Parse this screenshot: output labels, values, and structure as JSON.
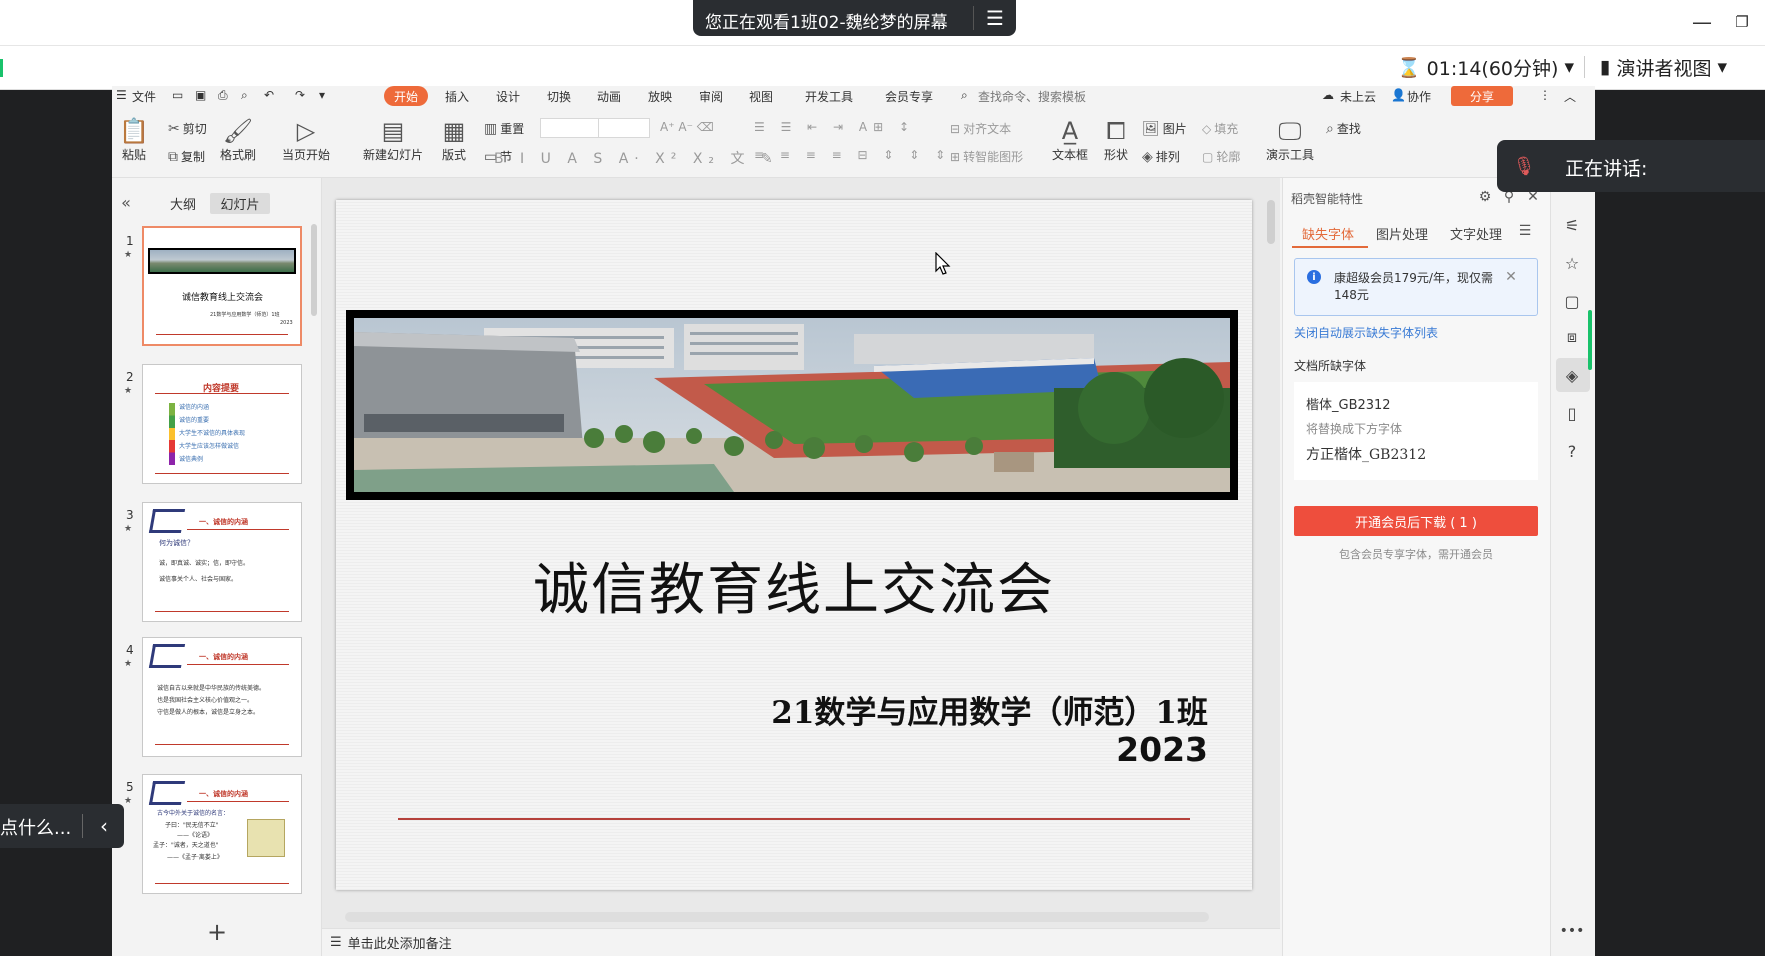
{
  "meeting": {
    "viewing_text": "您正在观看1班02-魏纶梦的屏幕",
    "timer": "01:14(60分钟)",
    "presenter_view": "演讲者视图",
    "speaking_label": "正在讲话:",
    "chat_placeholder": "点什么..."
  },
  "menu": {
    "file": "文件",
    "tabs": [
      "开始",
      "插入",
      "设计",
      "切换",
      "动画",
      "放映",
      "审阅",
      "视图",
      "开发工具",
      "会员专享"
    ],
    "search": "查找命令、搜索模板",
    "cloud": "未上云",
    "collab": "协作",
    "share": "分享"
  },
  "ribbon": {
    "paste": "粘贴",
    "cut": "剪切",
    "copy": "复制",
    "format_painter": "格式刷",
    "from_current": "当页开始",
    "new_slide": "新建幻灯片",
    "layout": "版式",
    "reset": "重置",
    "section": "节",
    "text_box": "文本框",
    "shape": "形状",
    "picture": "图片",
    "fill": "填充",
    "arrange": "排列",
    "outline": "轮廓",
    "presentation_tools": "演示工具",
    "find": "查找",
    "align_text": "对齐文本",
    "smart_shape": "转智能图形"
  },
  "left_panel": {
    "tab_outline": "大纲",
    "tab_slides": "幻灯片",
    "thumbs": [
      {
        "num": "1",
        "title": "诚信教育线上交流会",
        "sub": "21数学与应用数学（师范）1班",
        "year": "2023"
      },
      {
        "num": "2",
        "title": "内容提要",
        "lines": [
          "诚信的内涵",
          "诚信的重要",
          "大学生不诚信的具体表现",
          "大学生应该怎样做诚信",
          "诚信典例"
        ]
      },
      {
        "num": "3",
        "title": "一、诚信的内涵",
        "lines": [
          "何为诚信？",
          "诚，即真诚、诚实；信，即守信。",
          "诚信事关个人、社会与国家。"
        ]
      },
      {
        "num": "4",
        "title": "一、诚信的内涵",
        "lines": [
          "诚信自古以来就是中华民族的传统美德。",
          "也是我国社会主义核心价值观之一。",
          "守信是做人的根本，诚信是立身之本。"
        ]
      },
      {
        "num": "5",
        "title": "一、诚信的内涵",
        "lines": [
          "古今中外关于诚信的名言：",
          "子曰：\"民无信不立\"",
          "——《论语》",
          "孟子：\"诚者，天之道也\"",
          "——《孟子·离娄上》"
        ]
      }
    ]
  },
  "slide": {
    "title": "诚信教育线上交流会",
    "class": "21数学与应用数学（师范）1班",
    "year": "2023"
  },
  "notes_placeholder": "单击此处添加备注",
  "right_pane": {
    "title": "稻壳智能特性",
    "tabs": [
      "缺失字体",
      "图片处理",
      "文字处理"
    ],
    "promo": "康超级会员179元/年，现仅需148元",
    "close_auto": "关闭自动展示缺失字体列表",
    "missing_label": "文档所缺字体",
    "missing_font": "楷体_GB2312",
    "replace_label": "将替换成下方字体",
    "replacement_font": "方正楷体_GB2312",
    "download_button": "开通会员后下载 ( 1 )",
    "download_note": "包含会员专享字体，需开通会员"
  }
}
